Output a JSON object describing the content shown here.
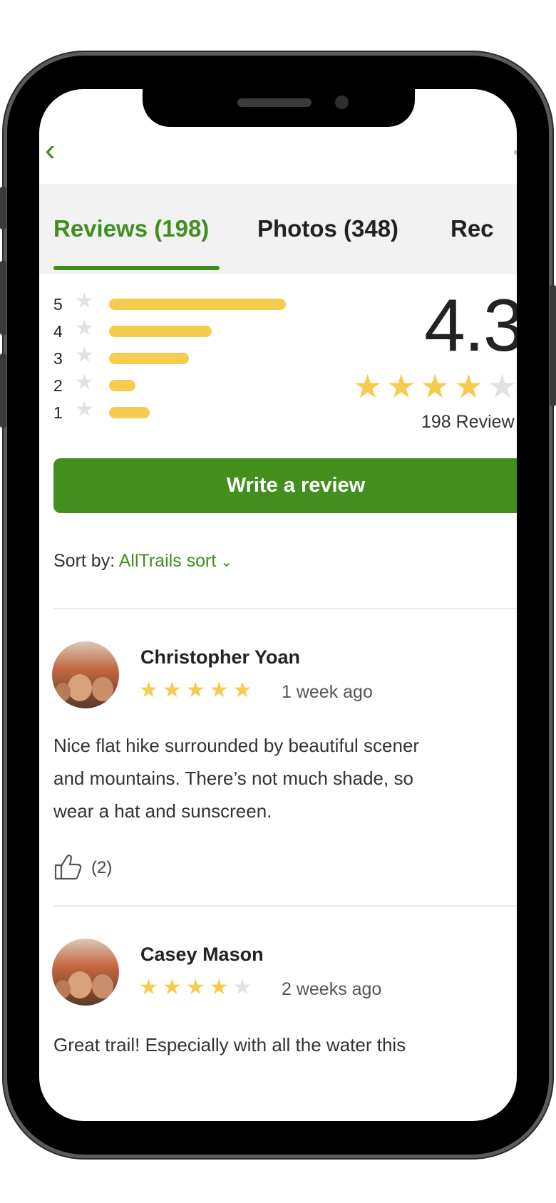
{
  "nav": {
    "back_icon": "chevron-left-icon"
  },
  "tabs": [
    {
      "label": "Reviews (198)",
      "active": true
    },
    {
      "label": "Photos (348)",
      "active": false
    },
    {
      "label": "Rec",
      "active": false
    }
  ],
  "rating_summary": {
    "average": "4.3",
    "review_count_text": "198 Review",
    "average_stars": 4.3,
    "histogram": [
      {
        "stars": "5",
        "share": 1.0
      },
      {
        "stars": "4",
        "share": 0.58
      },
      {
        "stars": "3",
        "share": 0.45
      },
      {
        "stars": "2",
        "share": 0.15
      },
      {
        "stars": "1",
        "share": 0.23
      }
    ]
  },
  "actions": {
    "write_review_label": "Write a review"
  },
  "sort": {
    "label": "Sort by:",
    "value": "AllTrails sort"
  },
  "reviews": [
    {
      "name": "Christopher Yoan",
      "stars": 5,
      "time": "1 week ago",
      "text_lines": [
        "Nice flat hike surrounded by beautiful scener",
        "and mountains. There’s not much shade, so",
        "wear a hat and sunscreen."
      ],
      "likes": "(2)"
    },
    {
      "name": "Casey Mason",
      "stars": 4,
      "time": "2 weeks ago",
      "text_lines": [
        "Great trail! Especially with all the water this"
      ]
    }
  ],
  "colors": {
    "accent_green": "#428f1e",
    "star_yellow": "#f5cc4e",
    "star_empty": "#e2e2e2"
  }
}
